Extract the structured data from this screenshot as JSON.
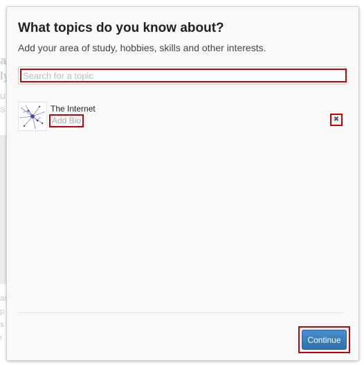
{
  "background": {
    "fragments": [
      "av",
      "ly",
      "U,",
      "S"
    ],
    "lower_fragments": [
      "as",
      "p",
      "s",
      "r"
    ]
  },
  "dialog": {
    "title": "What topics do you know about?",
    "subtitle": "Add your area of study, hobbies, skills and other interests.",
    "search": {
      "placeholder": "Search for a topic",
      "value": ""
    },
    "topics": [
      {
        "name": "The Internet",
        "add_bio_label": "Add Bio",
        "thumbnail_icon": "internet-map-icon",
        "remove_icon": "close-icon"
      }
    ],
    "continue_label": "Continue"
  },
  "colors": {
    "accent": "#3b7fc4",
    "highlight_outline": "#cc0000"
  }
}
